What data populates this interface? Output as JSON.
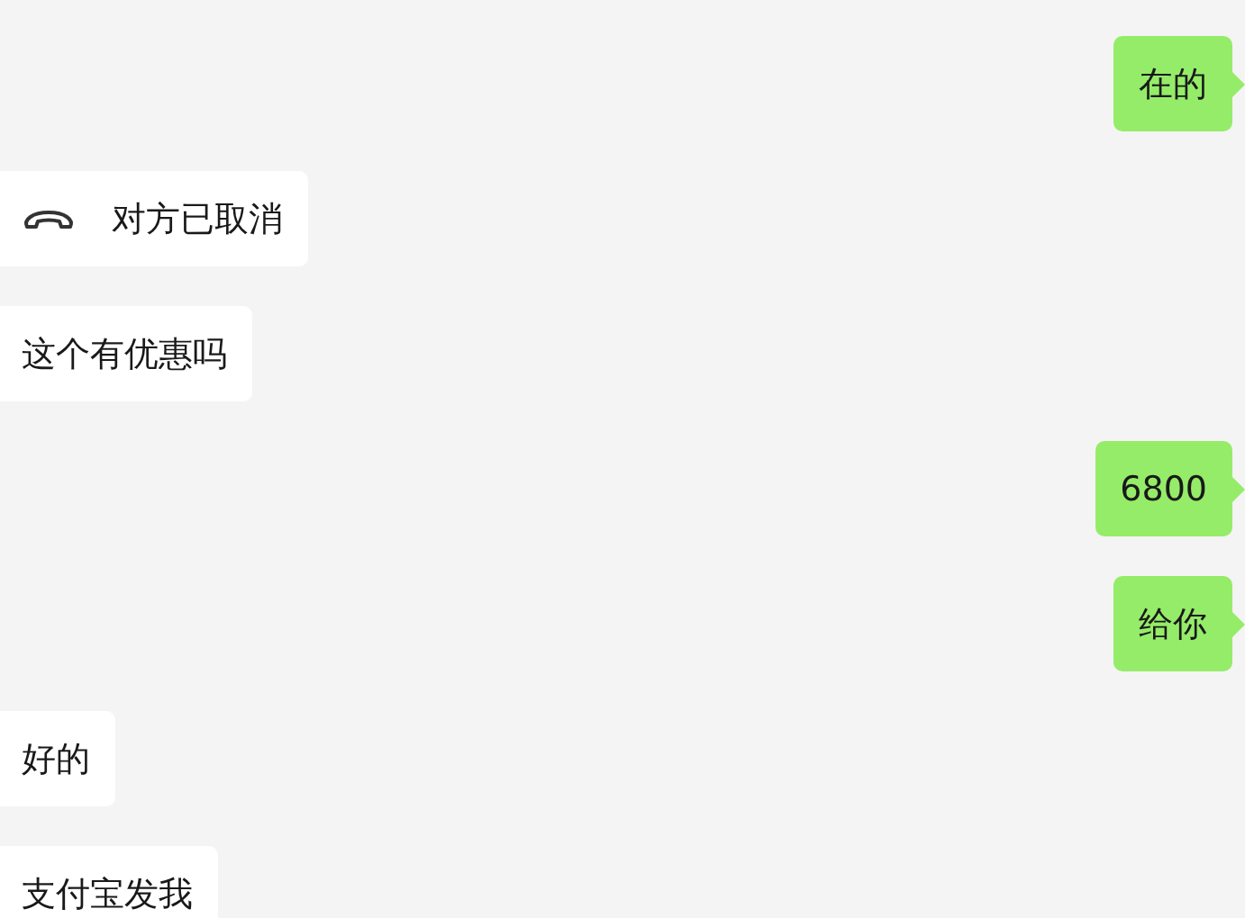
{
  "messages": [
    {
      "outgoing": true,
      "kind": "text",
      "text": "在的"
    },
    {
      "outgoing": false,
      "kind": "call",
      "text": "对方已取消"
    },
    {
      "outgoing": false,
      "kind": "text",
      "text": "这个有优惠吗"
    },
    {
      "outgoing": true,
      "kind": "text",
      "text": "6800"
    },
    {
      "outgoing": true,
      "kind": "text",
      "text": "给你"
    },
    {
      "outgoing": false,
      "kind": "text",
      "text": "好的"
    },
    {
      "outgoing": false,
      "kind": "text",
      "text": "支付宝发我"
    }
  ]
}
